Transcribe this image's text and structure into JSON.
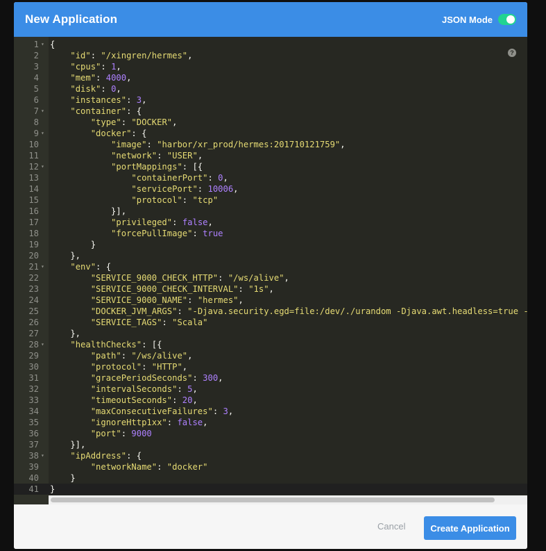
{
  "modal": {
    "title": "New Application",
    "json_mode_label": "JSON Mode",
    "json_mode_on": true,
    "help_icon": "?"
  },
  "editor": {
    "lines": [
      {
        "n": "1",
        "fold": true,
        "html": "{"
      },
      {
        "n": "2",
        "html": "    <span class='k'>\"id\"</span>: <span class='s'>\"/xingren/hermes\"</span>,"
      },
      {
        "n": "3",
        "html": "    <span class='k'>\"cpus\"</span>: <span class='n'>1</span>,"
      },
      {
        "n": "4",
        "html": "    <span class='k'>\"mem\"</span>: <span class='n'>4000</span>,"
      },
      {
        "n": "5",
        "html": "    <span class='k'>\"disk\"</span>: <span class='n'>0</span>,"
      },
      {
        "n": "6",
        "html": "    <span class='k'>\"instances\"</span>: <span class='n'>3</span>,"
      },
      {
        "n": "7",
        "fold": true,
        "html": "    <span class='k'>\"container\"</span>: {"
      },
      {
        "n": "8",
        "html": "        <span class='k'>\"type\"</span>: <span class='s'>\"DOCKER\"</span>,"
      },
      {
        "n": "9",
        "fold": true,
        "html": "        <span class='k'>\"docker\"</span>: {"
      },
      {
        "n": "10",
        "html": "            <span class='k'>\"image\"</span>: <span class='s'>\"harbor/xr_prod/hermes:201710121759\"</span>,"
      },
      {
        "n": "11",
        "html": "            <span class='k'>\"network\"</span>: <span class='s'>\"USER\"</span>,"
      },
      {
        "n": "12",
        "fold": true,
        "html": "            <span class='k'>\"portMappings\"</span>: [{"
      },
      {
        "n": "13",
        "html": "                <span class='k'>\"containerPort\"</span>: <span class='n'>0</span>,"
      },
      {
        "n": "14",
        "html": "                <span class='k'>\"servicePort\"</span>: <span class='n'>10006</span>,"
      },
      {
        "n": "15",
        "html": "                <span class='k'>\"protocol\"</span>: <span class='s'>\"tcp\"</span>"
      },
      {
        "n": "16",
        "html": "            }],"
      },
      {
        "n": "17",
        "html": "            <span class='k'>\"privileged\"</span>: <span class='b'>false</span>,"
      },
      {
        "n": "18",
        "html": "            <span class='k'>\"forcePullImage\"</span>: <span class='b'>true</span>"
      },
      {
        "n": "19",
        "html": "        }"
      },
      {
        "n": "20",
        "html": "    },"
      },
      {
        "n": "21",
        "fold": true,
        "html": "    <span class='k'>\"env\"</span>: {"
      },
      {
        "n": "22",
        "html": "        <span class='k'>\"SERVICE_9000_CHECK_HTTP\"</span>: <span class='s'>\"/ws/alive\"</span>,"
      },
      {
        "n": "23",
        "html": "        <span class='k'>\"SERVICE_9000_CHECK_INTERVAL\"</span>: <span class='s'>\"1s\"</span>,"
      },
      {
        "n": "24",
        "html": "        <span class='k'>\"SERVICE_9000_NAME\"</span>: <span class='s'>\"hermes\"</span>,"
      },
      {
        "n": "25",
        "html": "        <span class='k'>\"DOCKER_JVM_ARGS\"</span>: <span class='s'>\"-Djava.security.egd=file:/dev/./urandom -Djava.awt.headless=true -Df</span>"
      },
      {
        "n": "26",
        "html": "        <span class='k'>\"SERVICE_TAGS\"</span>: <span class='s'>\"Scala\"</span>"
      },
      {
        "n": "27",
        "html": "    },"
      },
      {
        "n": "28",
        "fold": true,
        "html": "    <span class='k'>\"healthChecks\"</span>: [{"
      },
      {
        "n": "29",
        "html": "        <span class='k'>\"path\"</span>: <span class='s'>\"/ws/alive\"</span>,"
      },
      {
        "n": "30",
        "html": "        <span class='k'>\"protocol\"</span>: <span class='s'>\"HTTP\"</span>,"
      },
      {
        "n": "31",
        "html": "        <span class='k'>\"gracePeriodSeconds\"</span>: <span class='n'>300</span>,"
      },
      {
        "n": "32",
        "html": "        <span class='k'>\"intervalSeconds\"</span>: <span class='n'>5</span>,"
      },
      {
        "n": "33",
        "html": "        <span class='k'>\"timeoutSeconds\"</span>: <span class='n'>20</span>,"
      },
      {
        "n": "34",
        "html": "        <span class='k'>\"maxConsecutiveFailures\"</span>: <span class='n'>3</span>,"
      },
      {
        "n": "35",
        "html": "        <span class='k'>\"ignoreHttp1xx\"</span>: <span class='b'>false</span>,"
      },
      {
        "n": "36",
        "html": "        <span class='k'>\"port\"</span>: <span class='n'>9000</span>"
      },
      {
        "n": "37",
        "html": "    }],"
      },
      {
        "n": "38",
        "fold": true,
        "html": "    <span class='k'>\"ipAddress\"</span>: {"
      },
      {
        "n": "39",
        "html": "        <span class='k'>\"networkName\"</span>: <span class='s'>\"docker\"</span>"
      },
      {
        "n": "40",
        "html": "    }"
      },
      {
        "n": "41",
        "active": true,
        "html": "}"
      }
    ]
  },
  "footer": {
    "cancel_label": "Cancel",
    "create_label": "Create Application"
  },
  "colors": {
    "header": "#3b8de6",
    "toggle": "#22d491",
    "editor_bg": "#272822",
    "primary_button": "#3b8de6"
  }
}
